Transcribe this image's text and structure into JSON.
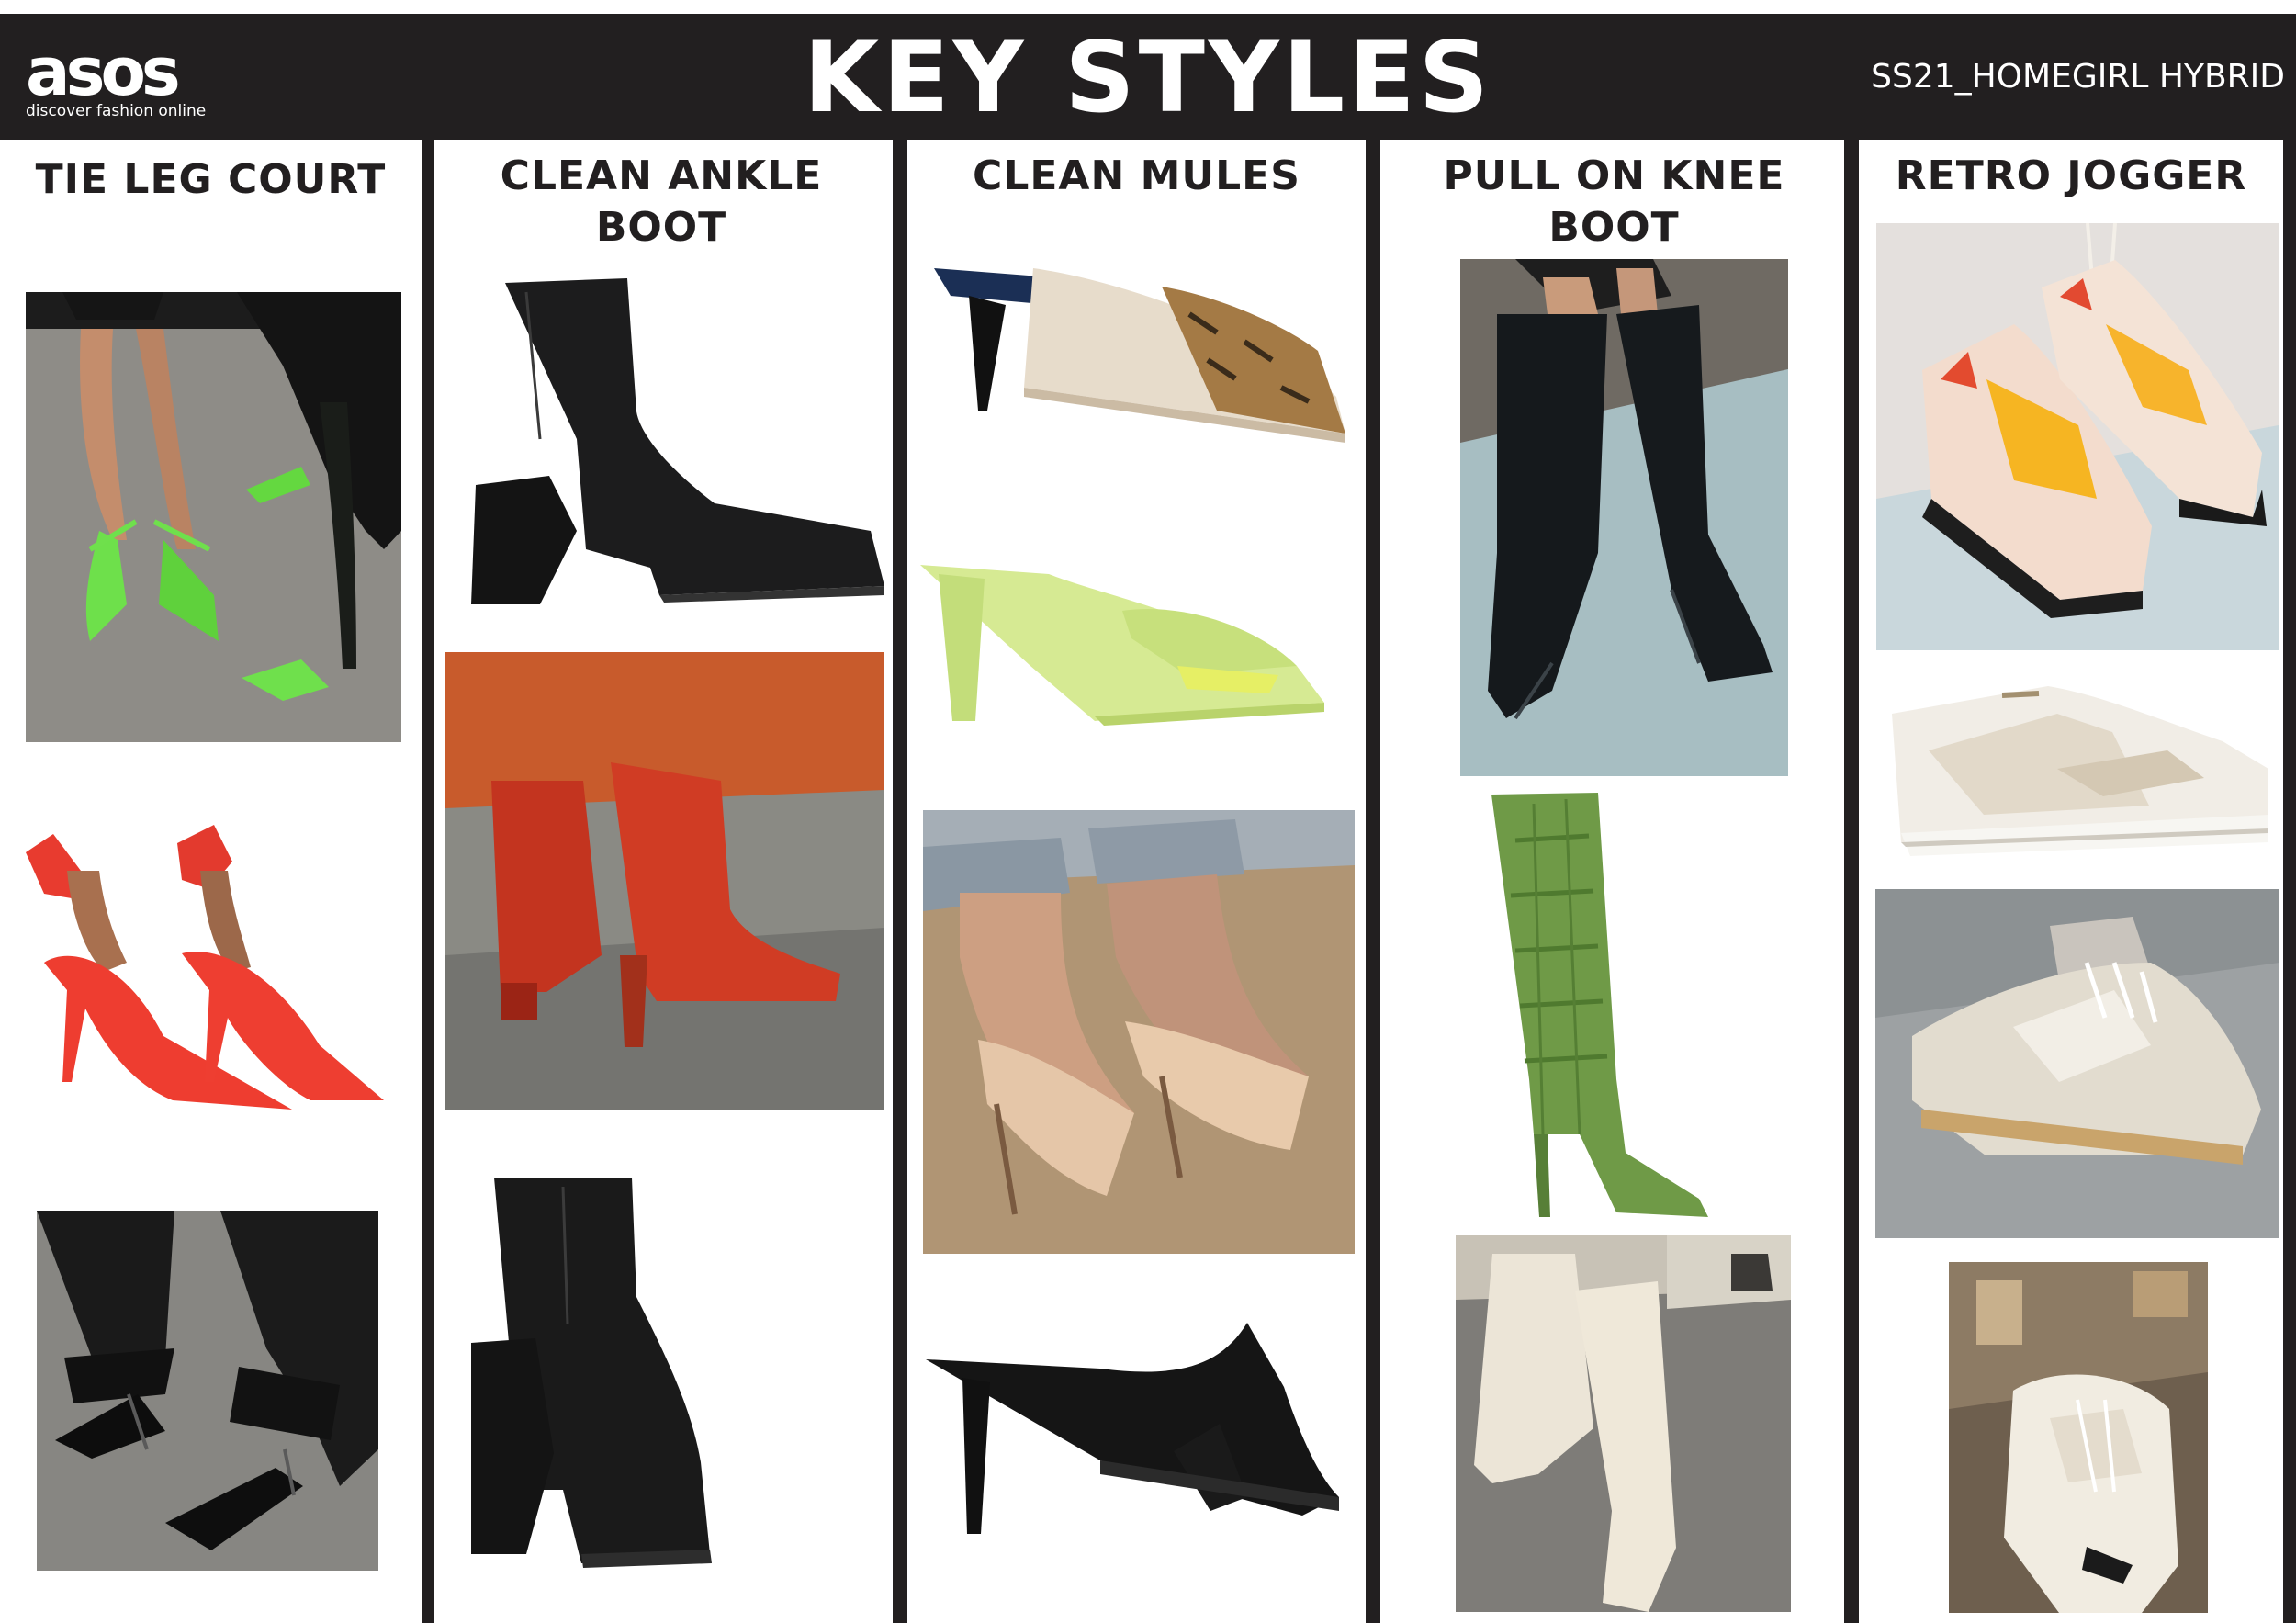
{
  "header": {
    "logo_word": "asos",
    "logo_tagline": "discover fashion online",
    "title": "KEY STYLES",
    "season": "SS21_HOMEGIRL HYBRID"
  },
  "columns": [
    {
      "title": "TIE LEG COURT",
      "images": [
        {
          "icon": "green-tie-leg-court-legs-photo"
        },
        {
          "icon": "red-tie-leg-court-pumps-photo"
        },
        {
          "icon": "black-pointed-courts-tie-trousers-photo"
        }
      ]
    },
    {
      "title": "CLEAN ANKLE BOOT",
      "images": [
        {
          "icon": "black-ankle-boot-sculpted-heel-photo"
        },
        {
          "icon": "red-ankle-boots-photo"
        },
        {
          "icon": "black-ankle-boot-block-heel-photo"
        }
      ]
    },
    {
      "title": "CLEAN MULES",
      "images": [
        {
          "icon": "snakeskin-cream-mule-photo"
        },
        {
          "icon": "lime-green-mule-photo"
        },
        {
          "icon": "nude-mules-on-feet-photo"
        },
        {
          "icon": "black-toe-loop-mule-photo"
        }
      ]
    },
    {
      "title": "PULL ON KNEE BOOT",
      "images": [
        {
          "icon": "black-knee-boot-on-leg-photo"
        },
        {
          "icon": "green-croc-knee-boot-photo"
        },
        {
          "icon": "cream-knee-boots-street-photo"
        }
      ]
    },
    {
      "title": "RETRO JOGGER",
      "images": [
        {
          "icon": "hanging-retro-sneakers-photo"
        },
        {
          "icon": "white-retro-sneaker-photo"
        },
        {
          "icon": "beige-jogger-on-foot-photo"
        },
        {
          "icon": "white-chunky-sneaker-photo"
        }
      ]
    }
  ],
  "colors": {
    "header_bg": "#221f20",
    "header_text": "#ffffff",
    "title_text": "#221f20",
    "divider": "#221f20"
  }
}
